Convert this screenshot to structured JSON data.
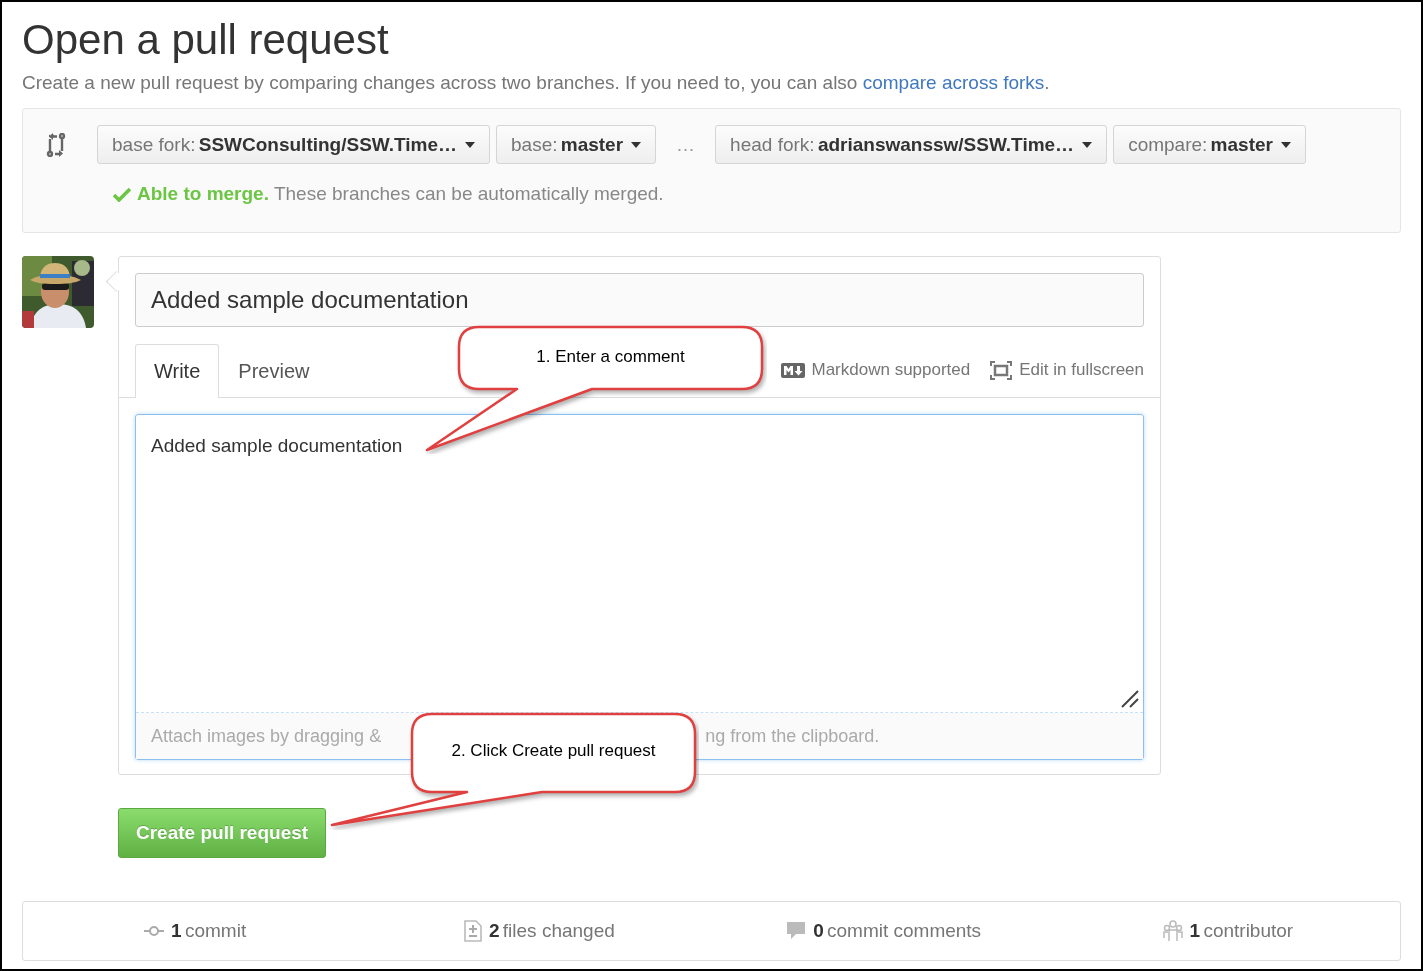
{
  "header": {
    "title": "Open a pull request",
    "subtitle": "Create a new pull request by comparing changes across two branches. If you need to, you can also ",
    "subtitle_link": "compare across forks",
    "subtitle_end": "."
  },
  "range": {
    "base_selectors": [
      {
        "label": "base fork:",
        "value": "SSWConsulting/SSW.Time…"
      },
      {
        "label": "base:",
        "value": "master"
      }
    ],
    "separator": "…",
    "head_selectors": [
      {
        "label": "head fork:",
        "value": "adrianswanssw/SSW.Time…"
      },
      {
        "label": "compare:",
        "value": "master"
      }
    ],
    "mergeable": true,
    "merge_status": "Able to merge.",
    "merge_message": "These branches can be automatically merged."
  },
  "composer": {
    "title_value": "Added sample documentation",
    "tabs": [
      {
        "label": "Write",
        "selected": true
      },
      {
        "label": "Preview",
        "selected": false
      }
    ],
    "markdown_hint": "Markdown supported",
    "fullscreen_link": "Edit in fullscreen",
    "body_value": "Added sample documentation",
    "attach_hint_start": "Attach images by dragging &",
    "attach_hint_end": "ng from the clipboard.",
    "submit_label": "Create pull request"
  },
  "callouts": [
    {
      "text": "1. Enter a comment"
    },
    {
      "text": "2. Click Create pull request"
    }
  ],
  "stats": [
    {
      "kind": "commit",
      "count": "1",
      "label": "commit"
    },
    {
      "kind": "files",
      "count": "2",
      "label": "files changed"
    },
    {
      "kind": "comments",
      "count": "0",
      "label": "commit comments"
    },
    {
      "kind": "contributor",
      "count": "1",
      "label": "contributor"
    }
  ]
}
